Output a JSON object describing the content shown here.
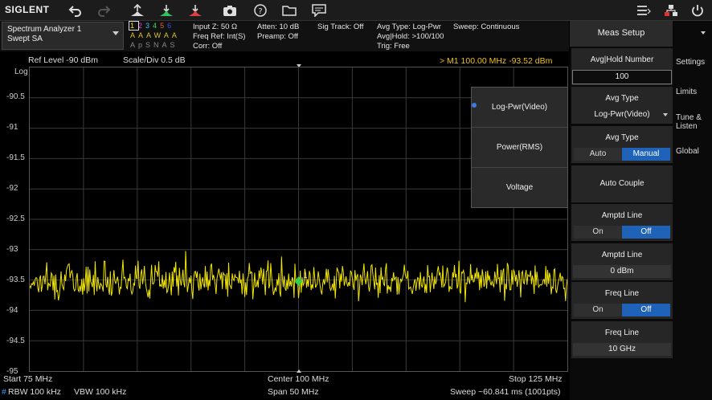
{
  "toolbar": {
    "logo": "SIGLENT",
    "icons": [
      "undo-icon",
      "redo-icon",
      "peak-icon",
      "marker-to-center-icon",
      "marker-to-ref-icon",
      "camera-icon",
      "help-icon",
      "folder-icon",
      "message-icon",
      "menu-icon",
      "network-icon",
      "power-icon"
    ]
  },
  "status": {
    "mode_line1": "Spectrum Analyzer 1",
    "mode_line2": "Swept SA",
    "traces_numbers": [
      "1",
      "2",
      "3",
      "4",
      "5",
      "6"
    ],
    "traces_colors": [
      "#f2e600",
      "#e040e0",
      "#30c0e0",
      "#30e060",
      "#e06030",
      "#3050e0"
    ],
    "trace_type_row": [
      "A",
      "A",
      "A",
      "W",
      "A",
      "A"
    ],
    "trace_det_row": [
      "A",
      "p",
      "S",
      "N",
      "A",
      "S"
    ],
    "input_z": "Input Z: 50 Ω",
    "freq_ref": "Freq Ref: Int(S)",
    "corr": "Corr: Off",
    "atten": "Atten: 10 dB",
    "preamp": "Preamp: Off",
    "sig_track": "Sig Track: Off",
    "avg_type": "Avg Type: Log-Pwr",
    "avg_hold": "Avg|Hold: >100/100",
    "trig": "Trig: Free",
    "sweep": "Sweep: Continuous"
  },
  "plot": {
    "ref_level": "Ref Level  -90 dBm",
    "scale_div": "Scale/Div  0.5 dB",
    "marker_readout": "> M1   100.00 MHz  -93.52 dBm",
    "log_label": "Log",
    "marker_label": "1",
    "y_labels": [
      "-90.5",
      "-91",
      "-91.5",
      "-92",
      "-92.5",
      "-93",
      "-93.5",
      "-94",
      "-94.5",
      "-95"
    ],
    "start": "Start  75 MHz",
    "center": "Center  100 MHz",
    "stop": "Stop  125 MHz",
    "rbw_prefix": "#",
    "rbw": "RBW  100 kHz",
    "vbw": "VBW  100 kHz",
    "span": "Span  50 MHz",
    "sweep_time": "Sweep  ~60.841 ms (1001pts)"
  },
  "chart_data": {
    "type": "line",
    "ref_level_dbm": -90,
    "scale_per_div_db": 0.5,
    "ylim": [
      -95,
      -90
    ],
    "xlim_mhz": [
      75,
      125
    ],
    "trace_color": "#f2e600",
    "noise_floor_dbm": -93.5,
    "marker": {
      "x_mhz": 100,
      "y_dbm": -93.52
    }
  },
  "panel": {
    "title": "Meas Setup",
    "avg_hold_label": "Avg|Hold Number",
    "avg_hold_value": "100",
    "avg_type_label": "Avg Type",
    "avg_type_value": "Log-Pwr(Video)",
    "avg_type2_label": "Avg Type",
    "auto": "Auto",
    "manual": "Manual",
    "auto_couple": "Auto Couple",
    "amptd_line_label": "Amptd Line",
    "on": "On",
    "off": "Off",
    "amptd_line2_label": "Amptd Line",
    "amptd_value": "0 dBm",
    "freq_line_label": "Freq Line",
    "freq_line2_label": "Freq Line",
    "freq_value": "10 GHz",
    "tabs": [
      "Settings",
      "Limits",
      "Tune &\nListen",
      "Global"
    ]
  },
  "popup": {
    "options": [
      "Log-Pwr(Video)",
      "Power(RMS)",
      "Voltage"
    ]
  }
}
